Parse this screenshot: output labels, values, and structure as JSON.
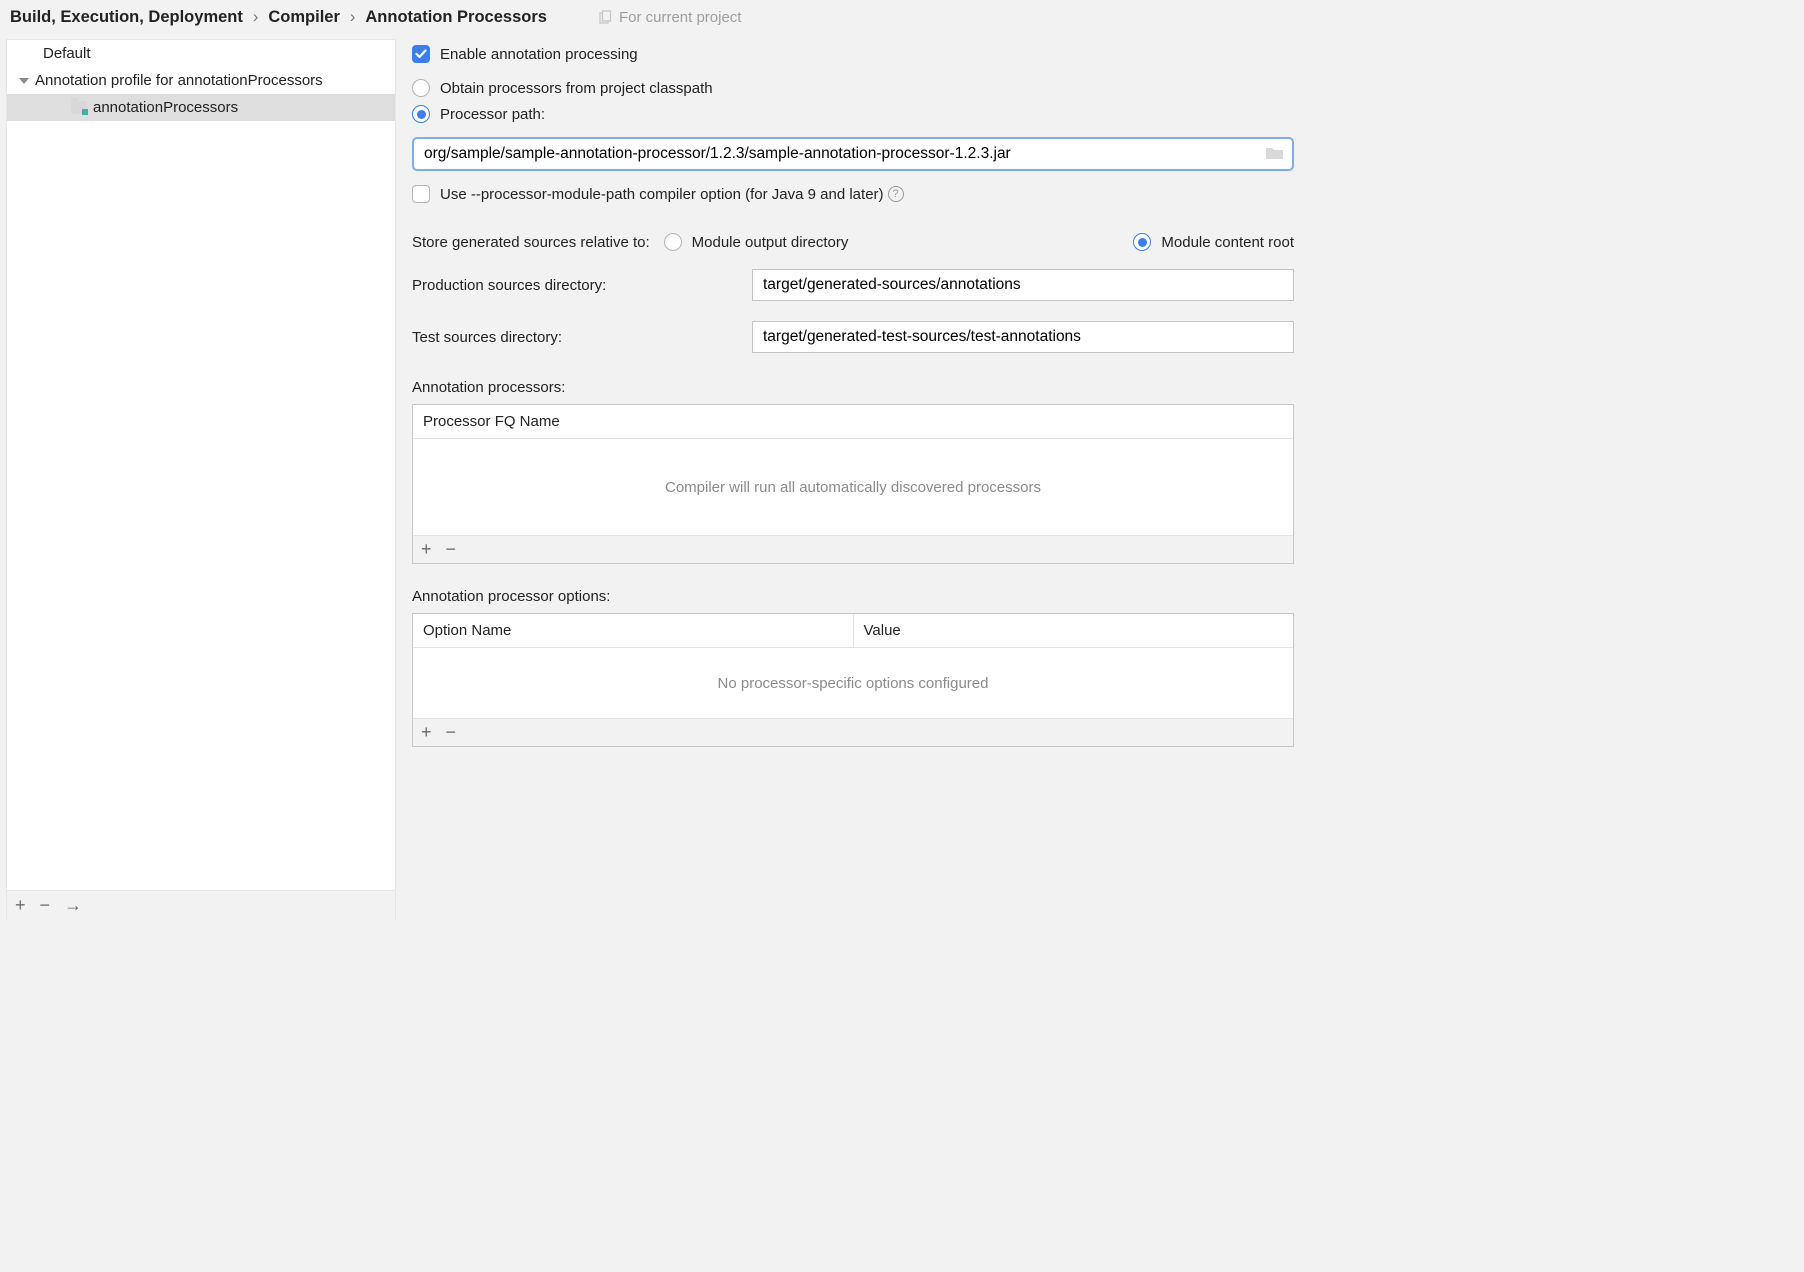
{
  "breadcrumb": {
    "part1": "Build, Execution, Deployment",
    "part2": "Compiler",
    "part3": "Annotation Processors",
    "sep": "›"
  },
  "scope_label": "For current project",
  "sidebar": {
    "items": [
      "Default",
      "Annotation profile for annotationProcessors",
      "annotationProcessors"
    ]
  },
  "main": {
    "enable_label": "Enable annotation processing",
    "obtain_label": "Obtain processors from project classpath",
    "processor_path_label": "Processor path:",
    "processor_path_value": "org/sample/sample-annotation-processor/1.2.3/sample-annotation-processor-1.2.3.jar",
    "module_path_label": "Use --processor-module-path compiler option (for Java 9 and later)",
    "store_label": "Store generated sources relative to:",
    "store_option1": "Module output directory",
    "store_option2": "Module content root",
    "prod_dir_label": "Production sources directory:",
    "prod_dir_value": "target/generated-sources/annotations",
    "test_dir_label": "Test sources directory:",
    "test_dir_value": "target/generated-test-sources/test-annotations",
    "ann_proc_label": "Annotation processors:",
    "ann_proc_col": "Processor FQ Name",
    "ann_proc_empty": "Compiler will run all automatically discovered processors",
    "opt_label": "Annotation processor options:",
    "opt_col1": "Option Name",
    "opt_col2": "Value",
    "opt_empty": "No processor-specific options configured"
  },
  "glyphs": {
    "plus": "+",
    "minus": "−",
    "arrow": "→",
    "help": "?"
  }
}
